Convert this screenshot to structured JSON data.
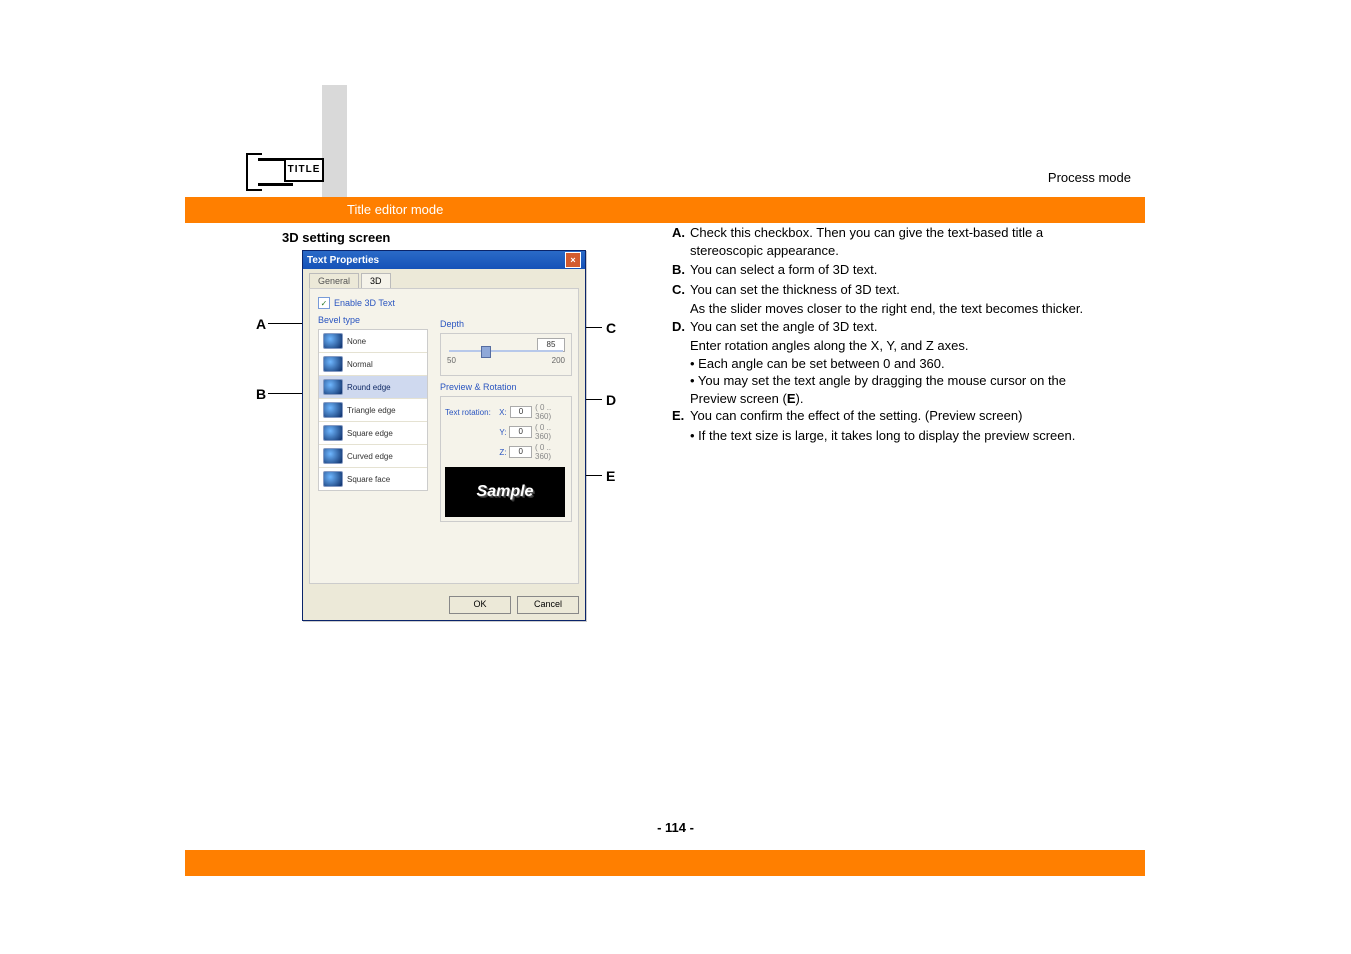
{
  "header": {
    "process_mode": "Process mode",
    "title_editor_mode": "Title editor mode",
    "icon_text": "TITLE"
  },
  "section_title": "3D setting screen",
  "dialog": {
    "title": "Text Properties",
    "tab_general": "General",
    "tab_3d": "3D",
    "enable_3d": "Enable 3D Text",
    "bevel_label": "Bevel type",
    "depth_label": "Depth",
    "depth_value": "85",
    "depth_min": "50",
    "depth_max": "200",
    "preview_rotation_label": "Preview & Rotation",
    "text_rotation_label": "Text rotation:",
    "rot_x_label": "X:",
    "rot_y_label": "Y:",
    "rot_z_label": "Z:",
    "rot_x": "0",
    "rot_y": "0",
    "rot_z": "0",
    "rot_range": "( 0 .. 360)",
    "sample_text": "Sample",
    "bevel_items": [
      "None",
      "Normal",
      "Round edge",
      "Triangle edge",
      "Square edge",
      "Curved edge",
      "Square face"
    ],
    "ok": "OK",
    "cancel": "Cancel"
  },
  "callouts": {
    "A": "A",
    "B": "B",
    "C": "C",
    "D": "D",
    "E": "E"
  },
  "descriptions": {
    "A": {
      "label": "A.",
      "text": "Check this checkbox. Then you can give the text-based title a stereoscopic appearance."
    },
    "B": {
      "label": "B.",
      "text": "You can select a form of 3D text."
    },
    "C": {
      "label": "C.",
      "text": "You can set the thickness of 3D text.",
      "sub": "As the slider moves closer to the right end, the text becomes thicker."
    },
    "D": {
      "label": "D.",
      "text": "You can set the angle of 3D text.",
      "sub": "Enter rotation angles along the X, Y, and Z axes.",
      "bul1": "• Each angle can be set between 0 and 360.",
      "bul2_a": "• You may set the text angle by dragging the mouse cursor on the Preview screen (",
      "bul2_b": "E",
      "bul2_c": ")."
    },
    "E": {
      "label": "E.",
      "text": "You can confirm the effect of the setting. (Preview screen)",
      "bul": "• If the text size is large, it takes long to display the preview screen."
    }
  },
  "page_number": "- 114 -"
}
